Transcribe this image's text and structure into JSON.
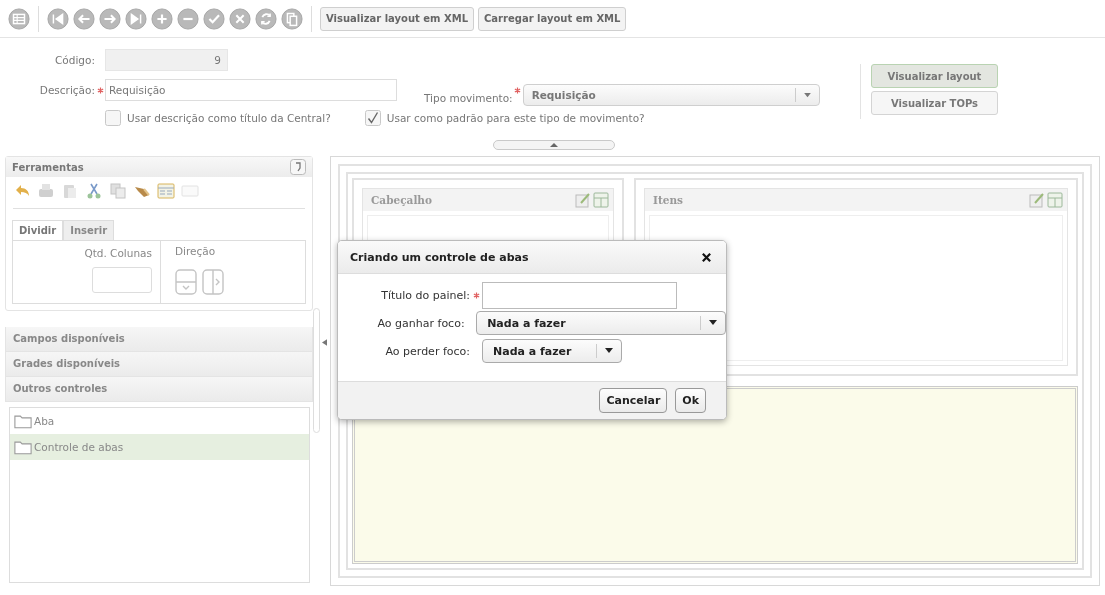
{
  "toolbar": {
    "buttons": [
      {
        "label": "Visualizar layout em XML"
      },
      {
        "label": "Carregar layout em XML"
      }
    ]
  },
  "form": {
    "codigo": {
      "label": "Código:",
      "value": "9"
    },
    "descricao": {
      "label": "Descrição:",
      "value": "Requisição",
      "required": true
    },
    "tipo_movimento": {
      "label": "Tipo movimento:",
      "value": "Requisição",
      "required": true
    },
    "checkboxes": [
      {
        "label": "Usar descrição como título da Central?",
        "checked": false
      },
      {
        "label": "Usar como padrão para este tipo de movimento?",
        "checked": true
      }
    ],
    "buttons": [
      {
        "label": "Visualizar layout",
        "selected": true
      },
      {
        "label": "Visualizar TOPs",
        "selected": false
      }
    ]
  },
  "tools_panel": {
    "title": "Ferramentas",
    "tabs": [
      {
        "label": "Dividir",
        "selected": true
      },
      {
        "label": "Inserir",
        "selected": false
      }
    ],
    "columns_label": "Qtd. Colunas",
    "direction_label": "Direção"
  },
  "sections": [
    {
      "label": "Campos disponíveis"
    },
    {
      "label": "Grades disponíveis"
    },
    {
      "label": "Outros controles"
    }
  ],
  "controls": [
    {
      "label": "Aba",
      "selected": false
    },
    {
      "label": "Controle de abas",
      "selected": true
    }
  ],
  "canvas": {
    "panels": [
      {
        "title": "Cabeçalho"
      },
      {
        "title": "Itens"
      }
    ]
  },
  "dialog": {
    "title": "Criando um controle de abas",
    "fields": [
      {
        "label": "Título do painel:",
        "kind": "text",
        "required": true
      },
      {
        "label": "Ao ganhar foco:",
        "kind": "select",
        "value": "Nada a fazer"
      },
      {
        "label": "Ao perder foco:",
        "kind": "select",
        "value": "Nada a fazer"
      }
    ],
    "buttons": [
      {
        "label": "Cancelar"
      },
      {
        "label": "Ok"
      }
    ]
  }
}
